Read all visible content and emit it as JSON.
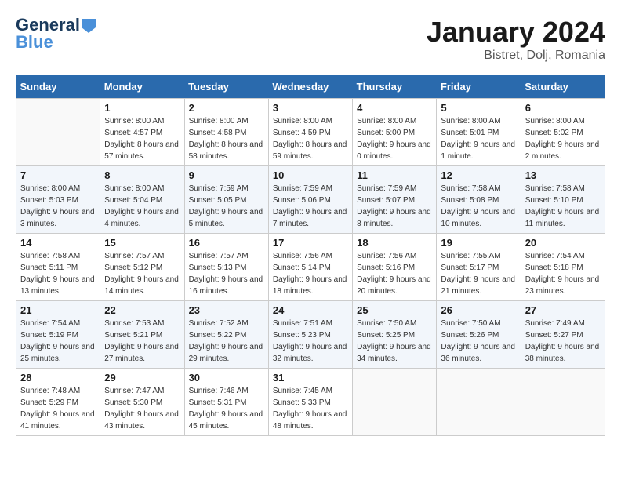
{
  "header": {
    "logo_line1": "General",
    "logo_line2": "Blue",
    "month_year": "January 2024",
    "location": "Bistret, Dolj, Romania"
  },
  "days_of_week": [
    "Sunday",
    "Monday",
    "Tuesday",
    "Wednesday",
    "Thursday",
    "Friday",
    "Saturday"
  ],
  "weeks": [
    [
      {
        "day": "",
        "sunrise": "",
        "sunset": "",
        "daylight": ""
      },
      {
        "day": "1",
        "sunrise": "Sunrise: 8:00 AM",
        "sunset": "Sunset: 4:57 PM",
        "daylight": "Daylight: 8 hours and 57 minutes."
      },
      {
        "day": "2",
        "sunrise": "Sunrise: 8:00 AM",
        "sunset": "Sunset: 4:58 PM",
        "daylight": "Daylight: 8 hours and 58 minutes."
      },
      {
        "day": "3",
        "sunrise": "Sunrise: 8:00 AM",
        "sunset": "Sunset: 4:59 PM",
        "daylight": "Daylight: 8 hours and 59 minutes."
      },
      {
        "day": "4",
        "sunrise": "Sunrise: 8:00 AM",
        "sunset": "Sunset: 5:00 PM",
        "daylight": "Daylight: 9 hours and 0 minutes."
      },
      {
        "day": "5",
        "sunrise": "Sunrise: 8:00 AM",
        "sunset": "Sunset: 5:01 PM",
        "daylight": "Daylight: 9 hours and 1 minute."
      },
      {
        "day": "6",
        "sunrise": "Sunrise: 8:00 AM",
        "sunset": "Sunset: 5:02 PM",
        "daylight": "Daylight: 9 hours and 2 minutes."
      }
    ],
    [
      {
        "day": "7",
        "sunrise": "Sunrise: 8:00 AM",
        "sunset": "Sunset: 5:03 PM",
        "daylight": "Daylight: 9 hours and 3 minutes."
      },
      {
        "day": "8",
        "sunrise": "Sunrise: 8:00 AM",
        "sunset": "Sunset: 5:04 PM",
        "daylight": "Daylight: 9 hours and 4 minutes."
      },
      {
        "day": "9",
        "sunrise": "Sunrise: 7:59 AM",
        "sunset": "Sunset: 5:05 PM",
        "daylight": "Daylight: 9 hours and 5 minutes."
      },
      {
        "day": "10",
        "sunrise": "Sunrise: 7:59 AM",
        "sunset": "Sunset: 5:06 PM",
        "daylight": "Daylight: 9 hours and 7 minutes."
      },
      {
        "day": "11",
        "sunrise": "Sunrise: 7:59 AM",
        "sunset": "Sunset: 5:07 PM",
        "daylight": "Daylight: 9 hours and 8 minutes."
      },
      {
        "day": "12",
        "sunrise": "Sunrise: 7:58 AM",
        "sunset": "Sunset: 5:08 PM",
        "daylight": "Daylight: 9 hours and 10 minutes."
      },
      {
        "day": "13",
        "sunrise": "Sunrise: 7:58 AM",
        "sunset": "Sunset: 5:10 PM",
        "daylight": "Daylight: 9 hours and 11 minutes."
      }
    ],
    [
      {
        "day": "14",
        "sunrise": "Sunrise: 7:58 AM",
        "sunset": "Sunset: 5:11 PM",
        "daylight": "Daylight: 9 hours and 13 minutes."
      },
      {
        "day": "15",
        "sunrise": "Sunrise: 7:57 AM",
        "sunset": "Sunset: 5:12 PM",
        "daylight": "Daylight: 9 hours and 14 minutes."
      },
      {
        "day": "16",
        "sunrise": "Sunrise: 7:57 AM",
        "sunset": "Sunset: 5:13 PM",
        "daylight": "Daylight: 9 hours and 16 minutes."
      },
      {
        "day": "17",
        "sunrise": "Sunrise: 7:56 AM",
        "sunset": "Sunset: 5:14 PM",
        "daylight": "Daylight: 9 hours and 18 minutes."
      },
      {
        "day": "18",
        "sunrise": "Sunrise: 7:56 AM",
        "sunset": "Sunset: 5:16 PM",
        "daylight": "Daylight: 9 hours and 20 minutes."
      },
      {
        "day": "19",
        "sunrise": "Sunrise: 7:55 AM",
        "sunset": "Sunset: 5:17 PM",
        "daylight": "Daylight: 9 hours and 21 minutes."
      },
      {
        "day": "20",
        "sunrise": "Sunrise: 7:54 AM",
        "sunset": "Sunset: 5:18 PM",
        "daylight": "Daylight: 9 hours and 23 minutes."
      }
    ],
    [
      {
        "day": "21",
        "sunrise": "Sunrise: 7:54 AM",
        "sunset": "Sunset: 5:19 PM",
        "daylight": "Daylight: 9 hours and 25 minutes."
      },
      {
        "day": "22",
        "sunrise": "Sunrise: 7:53 AM",
        "sunset": "Sunset: 5:21 PM",
        "daylight": "Daylight: 9 hours and 27 minutes."
      },
      {
        "day": "23",
        "sunrise": "Sunrise: 7:52 AM",
        "sunset": "Sunset: 5:22 PM",
        "daylight": "Daylight: 9 hours and 29 minutes."
      },
      {
        "day": "24",
        "sunrise": "Sunrise: 7:51 AM",
        "sunset": "Sunset: 5:23 PM",
        "daylight": "Daylight: 9 hours and 32 minutes."
      },
      {
        "day": "25",
        "sunrise": "Sunrise: 7:50 AM",
        "sunset": "Sunset: 5:25 PM",
        "daylight": "Daylight: 9 hours and 34 minutes."
      },
      {
        "day": "26",
        "sunrise": "Sunrise: 7:50 AM",
        "sunset": "Sunset: 5:26 PM",
        "daylight": "Daylight: 9 hours and 36 minutes."
      },
      {
        "day": "27",
        "sunrise": "Sunrise: 7:49 AM",
        "sunset": "Sunset: 5:27 PM",
        "daylight": "Daylight: 9 hours and 38 minutes."
      }
    ],
    [
      {
        "day": "28",
        "sunrise": "Sunrise: 7:48 AM",
        "sunset": "Sunset: 5:29 PM",
        "daylight": "Daylight: 9 hours and 41 minutes."
      },
      {
        "day": "29",
        "sunrise": "Sunrise: 7:47 AM",
        "sunset": "Sunset: 5:30 PM",
        "daylight": "Daylight: 9 hours and 43 minutes."
      },
      {
        "day": "30",
        "sunrise": "Sunrise: 7:46 AM",
        "sunset": "Sunset: 5:31 PM",
        "daylight": "Daylight: 9 hours and 45 minutes."
      },
      {
        "day": "31",
        "sunrise": "Sunrise: 7:45 AM",
        "sunset": "Sunset: 5:33 PM",
        "daylight": "Daylight: 9 hours and 48 minutes."
      },
      {
        "day": "",
        "sunrise": "",
        "sunset": "",
        "daylight": ""
      },
      {
        "day": "",
        "sunrise": "",
        "sunset": "",
        "daylight": ""
      },
      {
        "day": "",
        "sunrise": "",
        "sunset": "",
        "daylight": ""
      }
    ]
  ]
}
